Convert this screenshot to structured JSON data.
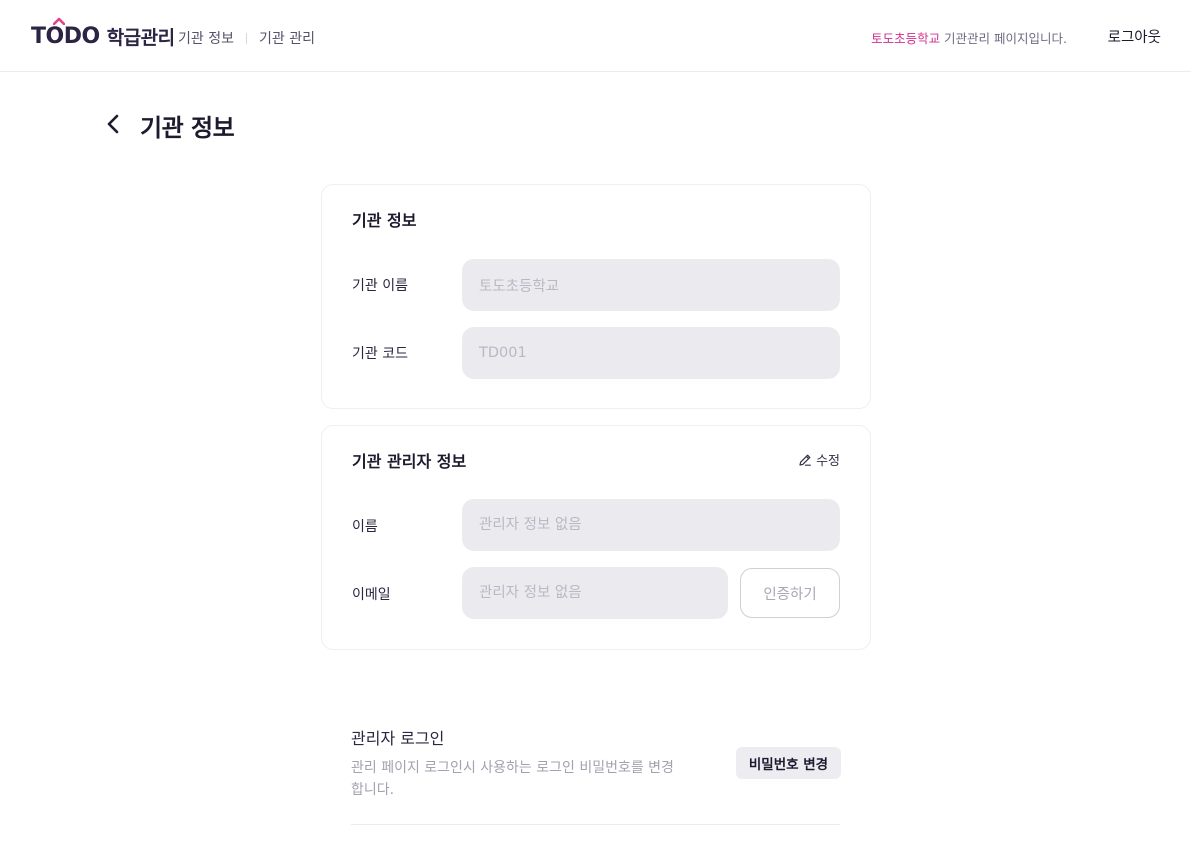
{
  "header": {
    "logo_mark": "TODO",
    "logo_text": "학급관리",
    "nav": [
      "기관 정보",
      "기관 관리"
    ],
    "notice_accent": "토도초등학교",
    "notice_rest": " 기관관리 페이지입니다.",
    "logout": "로그아웃"
  },
  "page": {
    "title": "기관 정보"
  },
  "institution_card": {
    "title": "기관 정보",
    "name_label": "기관 이름",
    "name_value": "토도초등학교",
    "code_label": "기관 코드",
    "code_value": "TD001"
  },
  "admin_card": {
    "title": "기관 관리자 정보",
    "edit_label": "수정",
    "name_label": "이름",
    "name_placeholder": "관리자 정보 없음",
    "email_label": "이메일",
    "email_placeholder": "관리자 정보 없음",
    "verify_label": "인증하기"
  },
  "admin_login": {
    "title": "관리자 로그인",
    "description": "관리 페이지 로그인시 사용하는 로그인 비밀번호를 변경합니다.",
    "change_password_label": "비밀번호 변경"
  },
  "colors": {
    "brand": "#2b2445",
    "accent": "#d2308f",
    "field_bg": "#ebebef"
  },
  "icons": {
    "back": "chevron-left-icon",
    "edit": "pencil-icon"
  }
}
